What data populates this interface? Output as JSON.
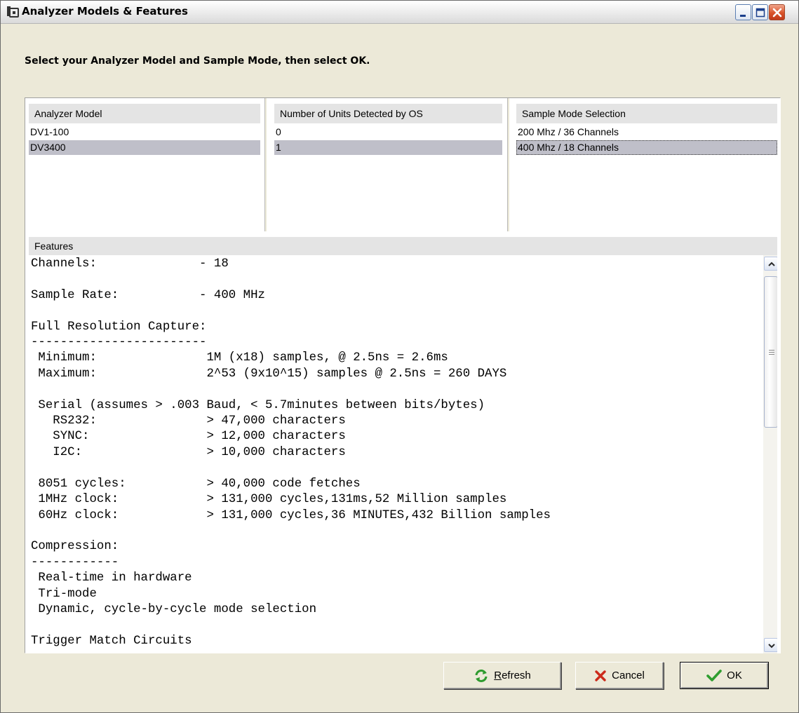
{
  "window": {
    "title": "Analyzer Models & Features"
  },
  "instruction": "Select your Analyzer Model and Sample Mode, then select OK.",
  "columns": {
    "model": {
      "header": "Analyzer Model",
      "items": [
        "DV1-100",
        "DV3400"
      ]
    },
    "units": {
      "header": "Number of Units Detected by OS",
      "items": [
        "0",
        "1"
      ]
    },
    "sample_mode": {
      "header": "Sample Mode Selection",
      "items": [
        "200 Mhz / 36 Channels",
        "400 Mhz / 18 Channels"
      ]
    },
    "selected_index": 1
  },
  "features": {
    "header": "Features",
    "text": "Channels:              - 18\n\nSample Rate:           - 400 MHz\n\nFull Resolution Capture:\n------------------------\n Minimum:               1M (x18) samples, @ 2.5ns = 2.6ms\n Maximum:               2^53 (9x10^15) samples @ 2.5ns = 260 DAYS\n\n Serial (assumes > .003 Baud, < 5.7minutes between bits/bytes)\n   RS232:               > 47,000 characters\n   SYNC:                > 12,000 characters\n   I2C:                 > 10,000 characters\n\n 8051 cycles:           > 40,000 code fetches\n 1MHz clock:            > 131,000 cycles,131ms,52 Million samples\n 60Hz clock:            > 131,000 cycles,36 MINUTES,432 Billion samples\n\nCompression:\n------------\n Real-time in hardware\n Tri-mode\n Dynamic, cycle-by-cycle mode selection\n\nTrigger Match Circuits"
  },
  "buttons": {
    "refresh_accel": "R",
    "refresh_rest": "efresh",
    "cancel": "Cancel",
    "ok": "OK"
  },
  "icons": {
    "app": "app-icon",
    "minimize": "minimize-icon",
    "maximize": "maximize-icon",
    "close": "close-icon",
    "refresh": "refresh-icon",
    "cancel": "x-icon",
    "ok": "checkmark-icon",
    "scroll_up": "chevron-up-icon",
    "scroll_down": "chevron-down-icon"
  },
  "colors": {
    "selection": "#bfbfc9",
    "refresh_icon": "#2e9b2e",
    "cancel_icon": "#cc2a1a",
    "ok_icon": "#2f9e2f",
    "close_button": "#d9532a"
  }
}
